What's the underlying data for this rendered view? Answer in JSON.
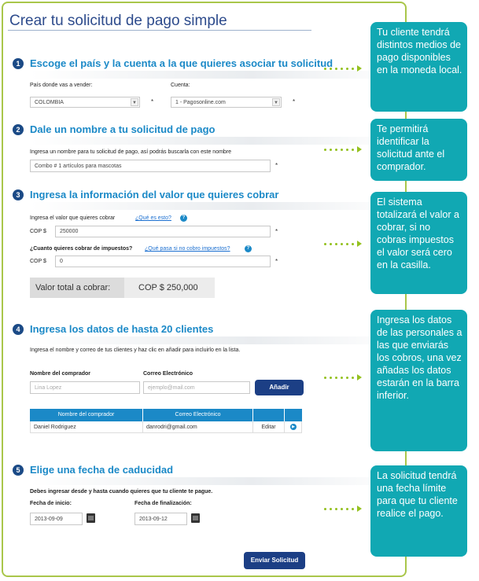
{
  "title": "Crear tu solicitud de pago simple",
  "step1": {
    "number": "1",
    "heading": "Escoge el país y la cuenta a la que quieres asociar tu solicitud",
    "country_label": "País donde vas a vender:",
    "country_value": "COLOMBIA",
    "account_label": "Cuenta:",
    "account_value": "1 - Pagosonline.com",
    "required_mark": "*"
  },
  "step2": {
    "number": "2",
    "heading": "Dale un nombre a tu solicitud de pago",
    "instruction": "Ingresa un nombre para tu solicitud de pago, así podrás buscarla con este nombre",
    "name_value": "Combo # 1 artículos para mascotas",
    "required_mark": "*"
  },
  "step3": {
    "number": "3",
    "heading": "Ingresa la información del valor que quieres cobrar",
    "value_label": "Ingresa el valor que quieres cobrar",
    "value_help_link": "¿Qué es esto?",
    "currency": "COP $",
    "value": "250000",
    "tax_label": "¿Cuanto quieres cobrar de impuestos?",
    "tax_help_link": "¿Qué pasa si no cobro impuestos?",
    "tax_value": "0",
    "total_label": "Valor total a cobrar:",
    "total_value": "COP $ 250,000",
    "help_icon": "?",
    "required_mark": "*"
  },
  "step4": {
    "number": "4",
    "heading": "Ingresa los datos de hasta 20 clientes",
    "instruction": "Ingresa el nombre y correo de tus clientes y haz clic en añadir para incluirlo en la lista.",
    "buyer_name_label": "Nombre del comprador",
    "email_label": "Correo Electrónico",
    "buyer_name_placeholder": "Lina Lopez",
    "email_placeholder": "ejemplo@mail.com",
    "add_button": "Añadir",
    "table": {
      "headers": [
        "Nombre del comprador",
        "Correo Electrónico"
      ],
      "rows": [
        {
          "name": "Daniel Rodriguez",
          "email": "danrodri@gmail.com",
          "action": "Editar"
        }
      ]
    }
  },
  "step5": {
    "number": "5",
    "heading": "Elige una fecha de caducidad",
    "instruction": "Debes ingresar desde y hasta cuando quieres que tu cliente te pague.",
    "start_label": "Fecha de inicio:",
    "start_value": "2013-09-09",
    "end_label": "Fecha de finalización:",
    "end_value": "2013-09-12"
  },
  "submit_button": "Enviar Solicitud",
  "callouts": [
    "Tu cliente tendrá distintos medios de pago disponibles en la moneda local.",
    "Te permitirá identificar la solicitud ante el comprador.",
    "El sistema totalizará el valor a cobrar, si no cobras impuestos  el valor será cero en la casilla.",
    "Ingresa los datos de las personales  a las que enviarás  los cobros, una vez añadas los datos estarán en la barra inferior.",
    "La solicitud tendrá una fecha límite para que tu cliente realice el pago."
  ],
  "colors": {
    "card_border": "#a9c64a",
    "heading": "#1b89c7",
    "step_number": "#1b4a86",
    "button": "#1c3f85",
    "callout": "#11a8b3",
    "arrow_dots": "#94c11f"
  },
  "icons": {
    "calendar": "calendar-icon",
    "help": "help-icon",
    "dropdown": "chevron-down-icon",
    "row_action": "arrow-right-icon"
  }
}
